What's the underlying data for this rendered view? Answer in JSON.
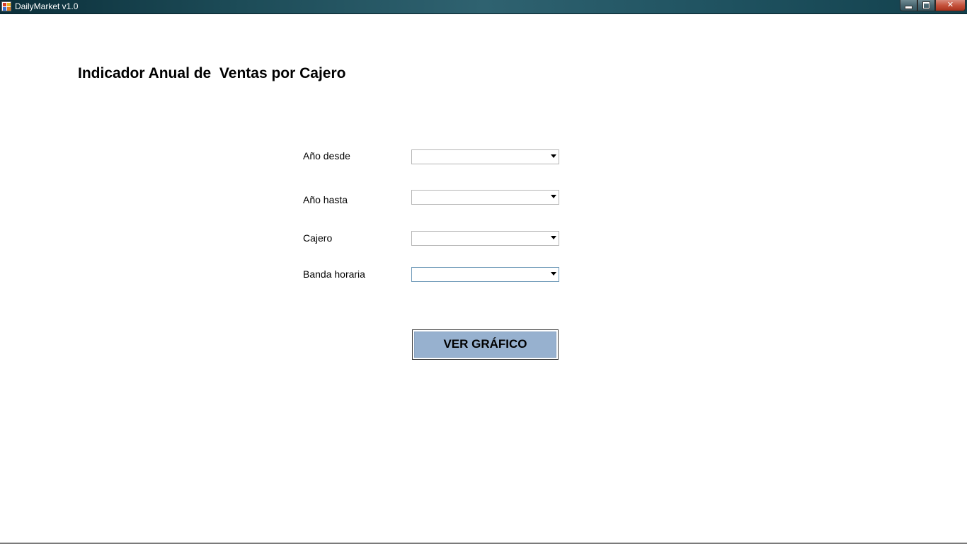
{
  "window": {
    "title": "DailyMarket v1.0",
    "buttons": {
      "minimize": "minimize-icon",
      "maximize": "maximize-icon",
      "close": "✕"
    }
  },
  "page": {
    "title": "Indicador Anual de  Ventas por Cajero"
  },
  "form": {
    "fields": [
      {
        "label": "Año desde",
        "value": ""
      },
      {
        "label": "Año hasta",
        "value": ""
      },
      {
        "label": "Cajero",
        "value": ""
      },
      {
        "label": "Banda horaria",
        "value": ""
      }
    ],
    "submit_label": "VER GRÁFICO"
  },
  "colors": {
    "titlebar": "#1d4c58",
    "button_fill": "#97b1cf",
    "focus_border": "#6e99b8"
  }
}
